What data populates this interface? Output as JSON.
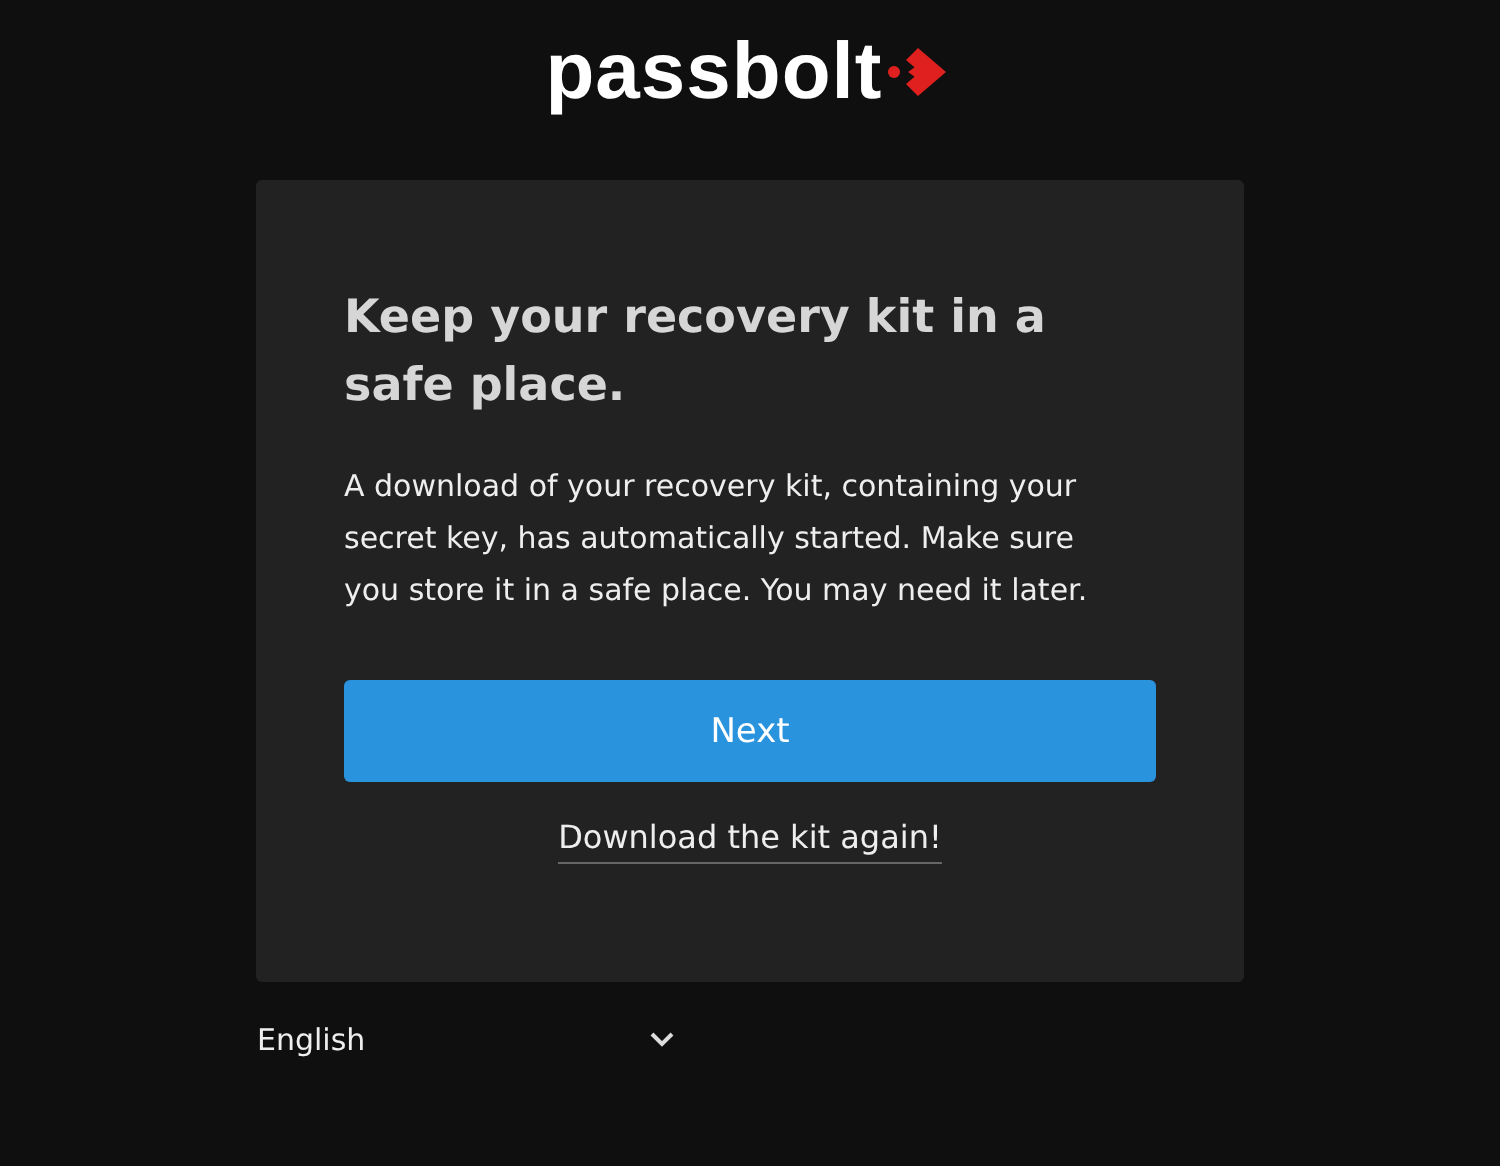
{
  "logo": {
    "text": "passbolt"
  },
  "card": {
    "title": "Keep your recovery kit in a safe place.",
    "message": "A download of your recovery kit, containing your secret key, has automatically started. Make sure you store it in a safe place. You may need it later.",
    "primary_button": "Next",
    "link": "Download the kit again!"
  },
  "language_select": {
    "value": "English"
  }
}
